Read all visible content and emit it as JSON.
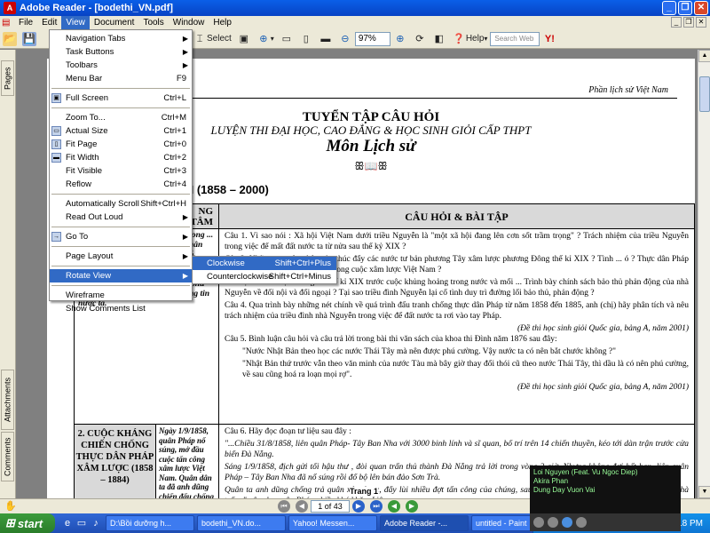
{
  "window": {
    "title": "Adobe Reader - [bodethi_VN.pdf]"
  },
  "menubar": [
    "File",
    "Edit",
    "View",
    "Document",
    "Tools",
    "Window",
    "Help"
  ],
  "toolbar": {
    "select_label": "Select",
    "zoom": "97%",
    "help_label": "Help",
    "search_placeholder": "Search Web"
  },
  "left_tabs": {
    "pages": "Pages",
    "attachments": "Attachments",
    "comments": "Comments"
  },
  "view_menu": {
    "items": [
      {
        "label": "Navigation Tabs",
        "arrow": true
      },
      {
        "label": "Task Buttons",
        "arrow": true
      },
      {
        "label": "Toolbars",
        "arrow": true
      },
      {
        "label": "Menu Bar",
        "shortcut": "F9"
      },
      {
        "label": "Full Screen",
        "shortcut": "Ctrl+L"
      },
      {
        "label": "Zoom To...",
        "shortcut": "Ctrl+M"
      },
      {
        "label": "Actual Size",
        "shortcut": "Ctrl+1"
      },
      {
        "label": "Fit Page",
        "shortcut": "Ctrl+0"
      },
      {
        "label": "Fit Width",
        "shortcut": "Ctrl+2"
      },
      {
        "label": "Fit Visible",
        "shortcut": "Ctrl+3"
      },
      {
        "label": "Reflow",
        "shortcut": "Ctrl+4"
      },
      {
        "label": "Automatically Scroll",
        "shortcut": "Shift+Ctrl+H"
      },
      {
        "label": "Read Out Loud",
        "arrow": true
      },
      {
        "label": "Go To",
        "arrow": true
      },
      {
        "label": "Page Layout",
        "arrow": true
      },
      {
        "label": "Rotate View",
        "arrow": true
      },
      {
        "label": "Wireframe"
      },
      {
        "label": "Show Comments List"
      }
    ]
  },
  "rotate_submenu": [
    {
      "label": "Clockwise",
      "shortcut": "Shift+Ctrl+Plus"
    },
    {
      "label": "Counterclockwise",
      "shortcut": "Shift+Ctrl+Minus"
    }
  ],
  "document": {
    "header": "Phần lịch sử Việt Nam",
    "title1": "TUYỂN TẬP CÂU HỎI",
    "title2": "LUYỆN THI ĐẠI HỌC, CAO ĐẲNG & HỌC SINH GIỎI CẤP THPT",
    "title3": "Môn Lịch sử",
    "ornament": "ꕥ📖ꕥ",
    "section": "AM (1858 – 2000)",
    "table_head_left": "NG\nTÂM",
    "table_head_right": "CÂU HỎI & BÀI TẬP",
    "row1_left": "XIX, sự ... mê về ... đẩy các ... phong ... nói tiếng từ triều ... tranh nạn nhân trực tiếp của cuộc chiến tranh đó. Thông qua các mối quan hệ đã có từ trước và lợi dụng sự suy yếu của chế độ phong kiến Việt Nam, Chính phủ Pháp nào triển xúc tiến việc thông tin nước ta.",
    "row1_right": [
      "Câu 1. Vì sao nói : Xã hội Việt Nam dưới triều Nguyễn là \"một xã hội đang lên cơn sốt trầm trọng\" ? Trách nhiệm của triều Nguyễn trong việc để mất đất nước ta từ nửa sau thế kỷ XIX ?",
      "Câu 2. Những nguyên nhân nào thúc đẩy các nước tư bản phương Tây xâm lược phương Đông thế kỉ XIX ? Tình ... ó ? Thực dân Pháp đã tiến hành những thủ đoạn gì trong cuộc xâm lược Việt Nam ?",
      "... o đặt ra cho Việt Nam giữa thế kỉ XIX trước cuộc khủng hoảng trong nước và mối ... Trình bày chính sách bảo thủ phản động của nhà Nguyễn về đối nội và đối ngoại ? Tại sao triều đình Nguyễn lại cố tình duy trì đường lối bảo thủ, phản động ?",
      "Câu 4. Qua trình bày những nét chính về quá trình đấu tranh chống thực dân Pháp từ năm 1858 đến 1885, anh (chị) hãy phân tích và nêu trách nhiệm của triều đình nhà Nguyễn trong việc để đất nước ta rơi vào tay Pháp."
    ],
    "cite1": "(Đề thi học sinh giỏi Quốc gia, bảng A, năm 2001)",
    "q5": "Câu 5. Bình luận câu hỏi và câu trả lời trong bài thi văn sách của khoa thi Đình năm 1876 sau đây:",
    "q5_b1": "\"Nước Nhật Bản theo học các nước Thái Tây mà nên được phú cường. Vậy nước ta có nên bắt chước không ?\"",
    "q5_b2": "\"Nhật Bản thứ trước vẫn theo văn minh của nước Tàu mà bây giờ thay đổi thói cũ theo nước Thái Tây, thì dầu là có nên phú cường, về sau cũng hoá ra loạn mọi rợ\".",
    "cite2": "(Đề thi học sinh giỏi Quốc gia, bảng A, năm 2001)",
    "row2_title": "2. CUỘC KHÁNG CHIẾN CHỐNG THỰC DÂN PHÁP XÂM LƯỢC (1858 – 1884)",
    "row2_mid": "Ngày 1/9/1858, quân Pháp nổ súng, mở đầu cuộc tấn công xâm lược Việt Nam. Quân dân ta đã anh dũng chiến đấu chống thực dân Pháp. Sau khi chiếm được thành Gia Định, quân",
    "q6": "Câu 6. Hãy đọc đoạn tư liệu sau đây :",
    "q6_quote1": "\"...Chiều 31/8/1858, liên quân Pháp- Tây Ban Nha với 3000 binh lính và sĩ quan, bố trí trên 14 chiến thuyền, kéo tới dàn trận trước cửa biển Đà Nẵng.",
    "q6_quote2": "Sáng 1/9/1858, địch gửi tối hậu thư , đòi quan trấn thủ thành Đà Nẵng trả lời trong vòng 2 giờ. Nhưng không đợi hết hạn, liên quân Pháp – Tây Ban Nha đã nổ súng rồi đổ bộ lên bán đảo Sơn Trà.",
    "q6_quote3": "Quân ta anh dũng chống trả quân xâm lược, đẩy lùi nhiều đợt tấn công của chúng, sau đó lại tích cực thực hiện \" vườn không, nhà trống\" gây cho quân Pháp nhiều khó khăn. Liên ...",
    "page_label": "Trang 1"
  },
  "statusbar": {
    "page": "1 of 43"
  },
  "media": {
    "line1": "Loi Nguyen (Feat. Vu Ngoc Diep)",
    "line2": "Akira Phan",
    "line3": "Dung Day Vuon Vai"
  },
  "taskbar": {
    "start": "start",
    "tasks": [
      "D:\\Bồi dưỡng h...",
      "bodethi_VN.do...",
      "Yahoo! Messen...",
      "Adobe Reader -...",
      "untitled - Paint"
    ],
    "time": "7:18 PM"
  }
}
